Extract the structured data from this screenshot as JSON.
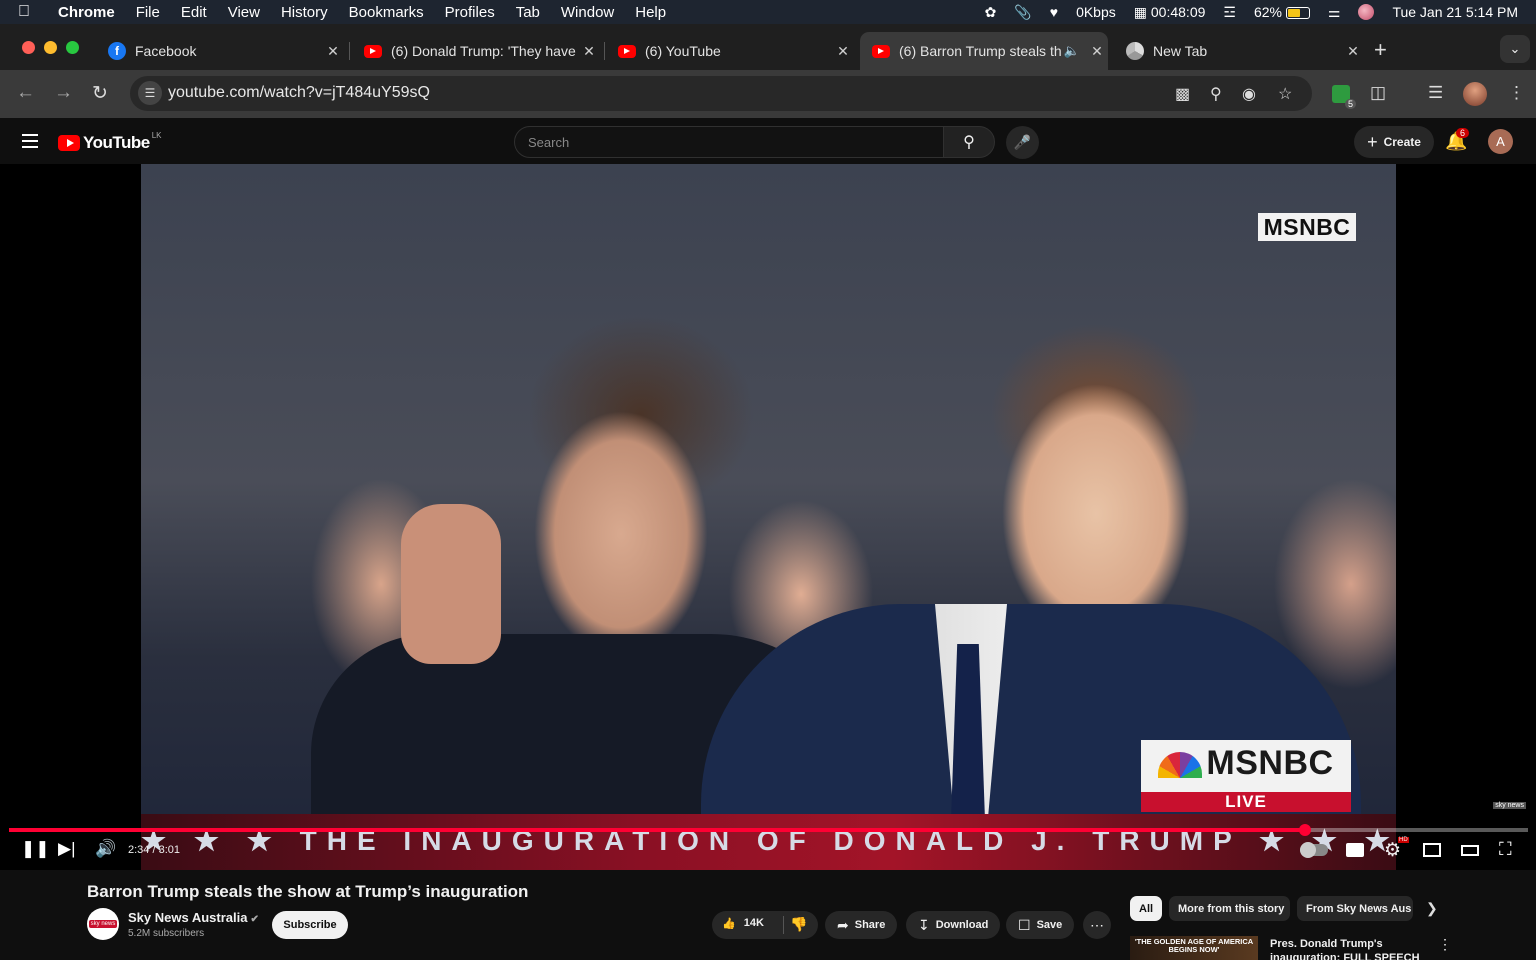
{
  "menubar": {
    "app": "Chrome",
    "items": [
      "File",
      "Edit",
      "View",
      "History",
      "Bookmarks",
      "Profiles",
      "Tab",
      "Window",
      "Help"
    ],
    "network": "0Kbps",
    "timer": "00:48:09",
    "battery": "62%",
    "battery_level": 0.62,
    "datetime": "Tue Jan 21  5:14 PM"
  },
  "tabs": [
    {
      "title": "Facebook",
      "favicon": "facebook-icon"
    },
    {
      "title": "(6) Donald Trump: 'They have",
      "favicon": "youtube-icon"
    },
    {
      "title": "(6) YouTube",
      "favicon": "youtube-icon"
    },
    {
      "title": "(6) Barron Trump steals th",
      "favicon": "youtube-icon",
      "active": true
    },
    {
      "title": "New Tab",
      "favicon": "chrome-icon"
    }
  ],
  "toolbar": {
    "url": "youtube.com/watch?v=jT484uY59sQ",
    "extension_badge": "5"
  },
  "youtube": {
    "logo_text": "YouTube",
    "country_code": "LK",
    "search_placeholder": "Search",
    "create_label": "Create",
    "notification_count": "6",
    "user_initial": "A"
  },
  "video": {
    "overlay_top": "MSNBC",
    "overlay_brand": "MSNBC",
    "overlay_live": "LIVE",
    "banner": "★ ★ ★  THE INAUGURATION OF DONALD J. TRUMP  ★ ★ ★",
    "sky_logo": "sky news",
    "time": "2:34 / 3:01",
    "progress": 0.853
  },
  "details": {
    "title": "Barron Trump steals the show at Trump’s inauguration",
    "channel": "Sky News Australia",
    "channel_avatar_text": "sky news",
    "subscribers": "5.2M subscribers",
    "subscribe_label": "Subscribe",
    "likes": "14K",
    "share_label": "Share",
    "download_label": "Download",
    "save_label": "Save"
  },
  "chips": [
    "All",
    "More from this story",
    "From Sky News Aus"
  ],
  "recommendation": {
    "thumb_text": "'THE GOLDEN AGE OF AMERICA BEGINS NOW'",
    "title": "Pres. Donald Trump's inauguration: FULL SPEECH"
  },
  "colors": {
    "youtube_red": "#ff0000",
    "progress_red": "#ff0033",
    "msnbc_red": "#c8102e",
    "background": "#0f0f0f"
  }
}
